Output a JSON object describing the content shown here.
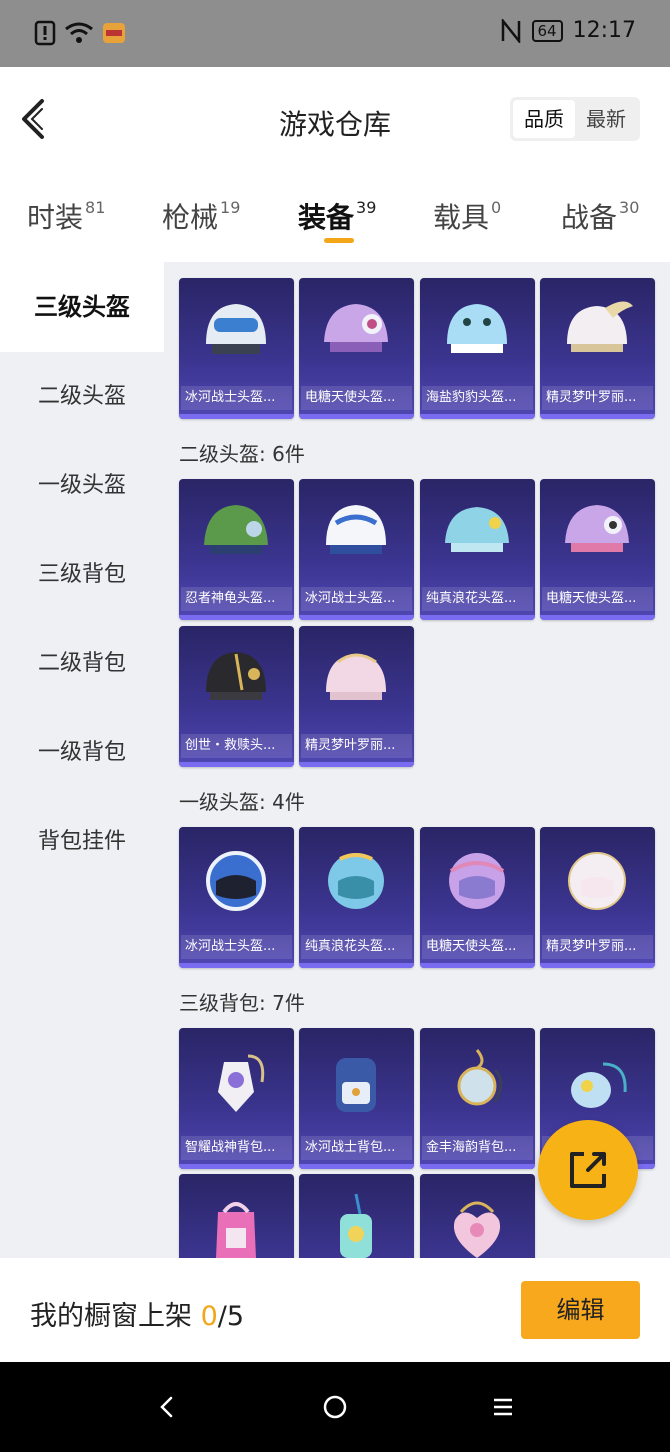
{
  "status_bar": {
    "time": "12:17",
    "battery": "64"
  },
  "header": {
    "title": "游戏仓库",
    "sort_options": [
      "品质",
      "最新"
    ],
    "active_sort": "品质"
  },
  "tabs": [
    {
      "label": "时装",
      "count": "81"
    },
    {
      "label": "枪械",
      "count": "19"
    },
    {
      "label": "装备",
      "count": "39",
      "active": true
    },
    {
      "label": "载具",
      "count": "0"
    },
    {
      "label": "战备",
      "count": "30"
    }
  ],
  "sidebar": {
    "items": [
      "三级头盔",
      "二级头盔",
      "一级头盔",
      "三级背包",
      "二级背包",
      "一级背包",
      "背包挂件"
    ],
    "active": "三级头盔"
  },
  "sections": [
    {
      "title": "",
      "items": [
        "冰河战士头盔...",
        "电糖天使头盔...",
        "海盐豹豹头盔...",
        "精灵梦叶罗丽..."
      ]
    },
    {
      "title": "二级头盔: 6件",
      "items": [
        "忍者神龟头盔...",
        "冰河战士头盔...",
        "纯真浪花头盔...",
        "电糖天使头盔...",
        "创世・救赎头...",
        "精灵梦叶罗丽..."
      ]
    },
    {
      "title": "一级头盔: 4件",
      "items": [
        "冰河战士头盔...",
        "纯真浪花头盔...",
        "电糖天使头盔...",
        "精灵梦叶罗丽..."
      ]
    },
    {
      "title": "三级背包: 7件",
      "items": [
        "智耀战神背包...",
        "冰河战士背包...",
        "金丰海韵背包...",
        "",
        "",
        "",
        ""
      ]
    }
  ],
  "bottom_bar": {
    "label": "我的橱窗上架",
    "current": "0",
    "total": "/5",
    "edit_label": "编辑"
  },
  "colors": {
    "accent": "#f2a618",
    "card_bg": "#3c3591",
    "card_border": "#7a6cf0"
  }
}
